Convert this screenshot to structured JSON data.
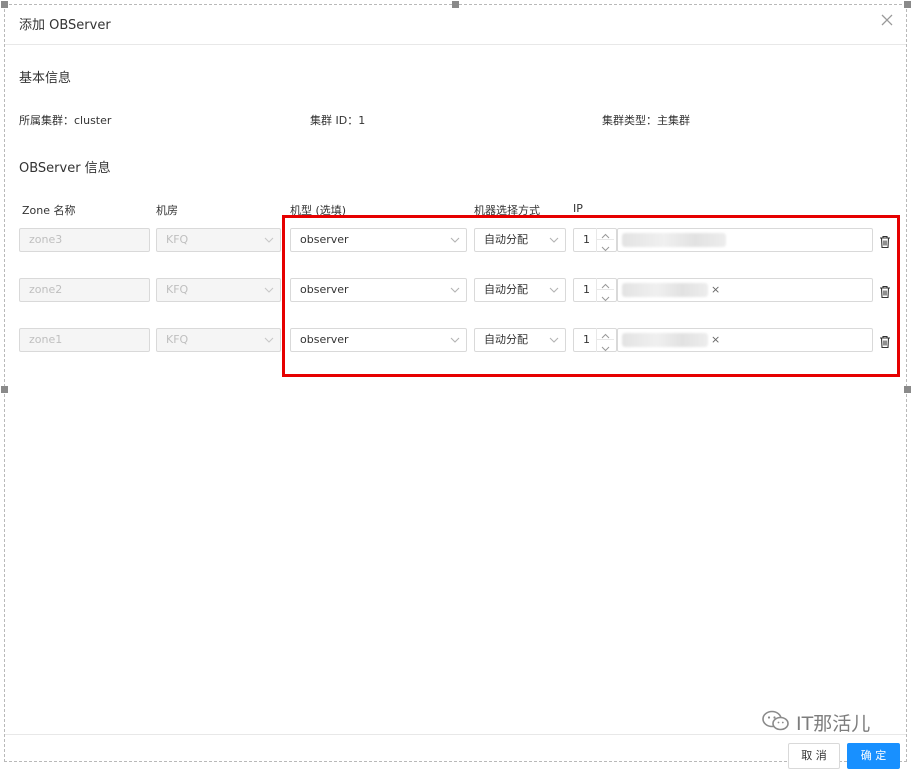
{
  "dialog": {
    "title": "添加 OBServer",
    "close_icon": "close-icon"
  },
  "basic_info": {
    "heading": "基本信息",
    "cluster_name": "所属集群：cluster",
    "cluster_id": "集群 ID：1",
    "cluster_type": "集群类型：主集群"
  },
  "observer_info": {
    "heading": "OBServer 信息",
    "columns": {
      "zone": "Zone 名称",
      "idc": "机房",
      "model": "机型 (选填)",
      "select_method": "机器选择方式",
      "ip": "IP"
    },
    "rows": [
      {
        "zone": "zone3",
        "idc": "KFQ",
        "model": "observer",
        "method": "自动分配",
        "count": "1",
        "ip_tag_removable": false
      },
      {
        "zone": "zone2",
        "idc": "KFQ",
        "model": "observer",
        "method": "自动分配",
        "count": "1",
        "ip_tag_removable": true,
        "remove_glyph": "×"
      },
      {
        "zone": "zone1",
        "idc": "KFQ",
        "model": "observer",
        "method": "自动分配",
        "count": "1",
        "ip_tag_removable": true,
        "remove_glyph": "×"
      }
    ]
  },
  "footer": {
    "cancel_label": "取 消",
    "ok_label": "确 定"
  },
  "watermark": {
    "text": "IT那活儿",
    "icon": "wechat-icon"
  },
  "colors": {
    "highlight_border": "#e60000",
    "primary": "#1890ff",
    "disabled_bg": "#f5f5f5"
  }
}
